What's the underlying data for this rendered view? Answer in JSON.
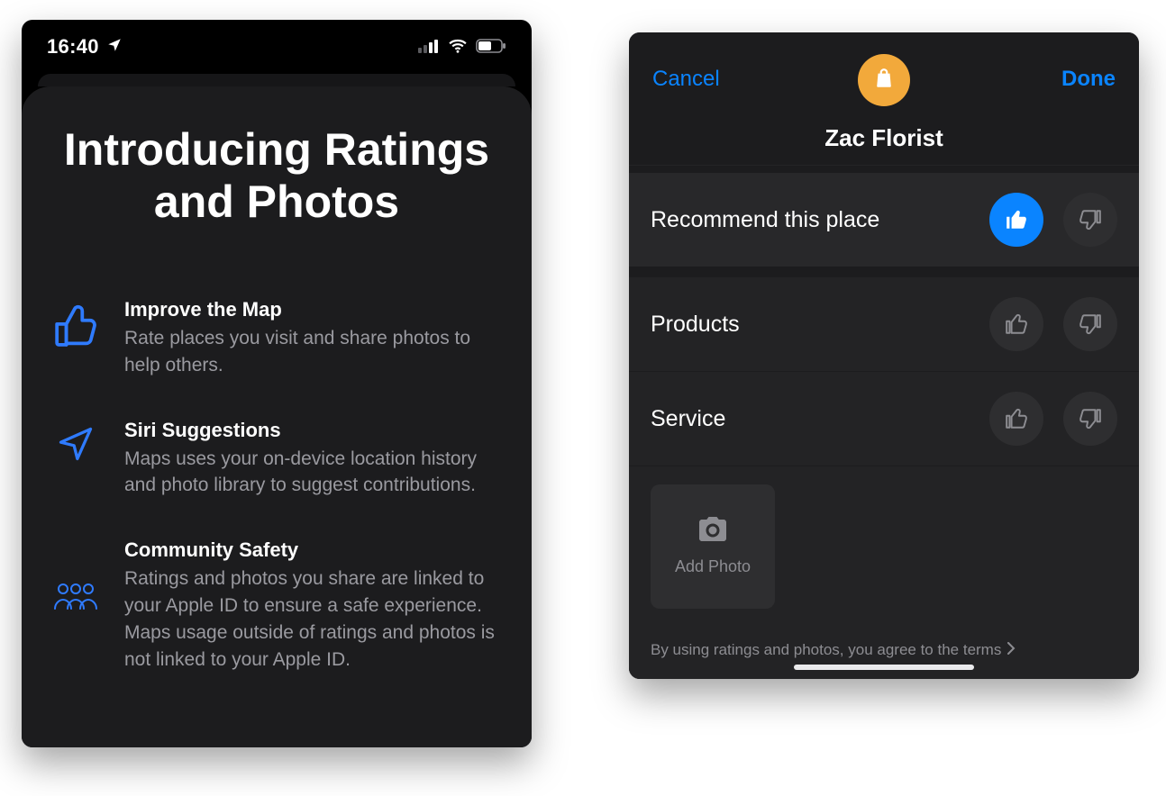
{
  "left": {
    "status": {
      "time": "16:40"
    },
    "intro": {
      "title": "Introducing Ratings and Photos",
      "features": [
        {
          "heading": "Improve the Map",
          "body": "Rate places you visit and share photos to help others."
        },
        {
          "heading": "Siri Suggestions",
          "body": "Maps uses your on-device location history and photo library to suggest contributions."
        },
        {
          "heading": "Community Safety",
          "body": "Ratings and photos you share are linked to your Apple ID to ensure a safe experience. Maps usage outside of ratings and photos is not linked to your Apple ID."
        }
      ]
    }
  },
  "right": {
    "header": {
      "cancel": "Cancel",
      "done": "Done",
      "place": "Zac Florist"
    },
    "rows": {
      "recommend": "Recommend this place",
      "products": "Products",
      "service": "Service"
    },
    "add_photo": "Add Photo",
    "terms": "By using ratings and photos, you agree to the terms",
    "colors": {
      "accent": "#0a84ff",
      "badge": "#f2a93b"
    }
  }
}
